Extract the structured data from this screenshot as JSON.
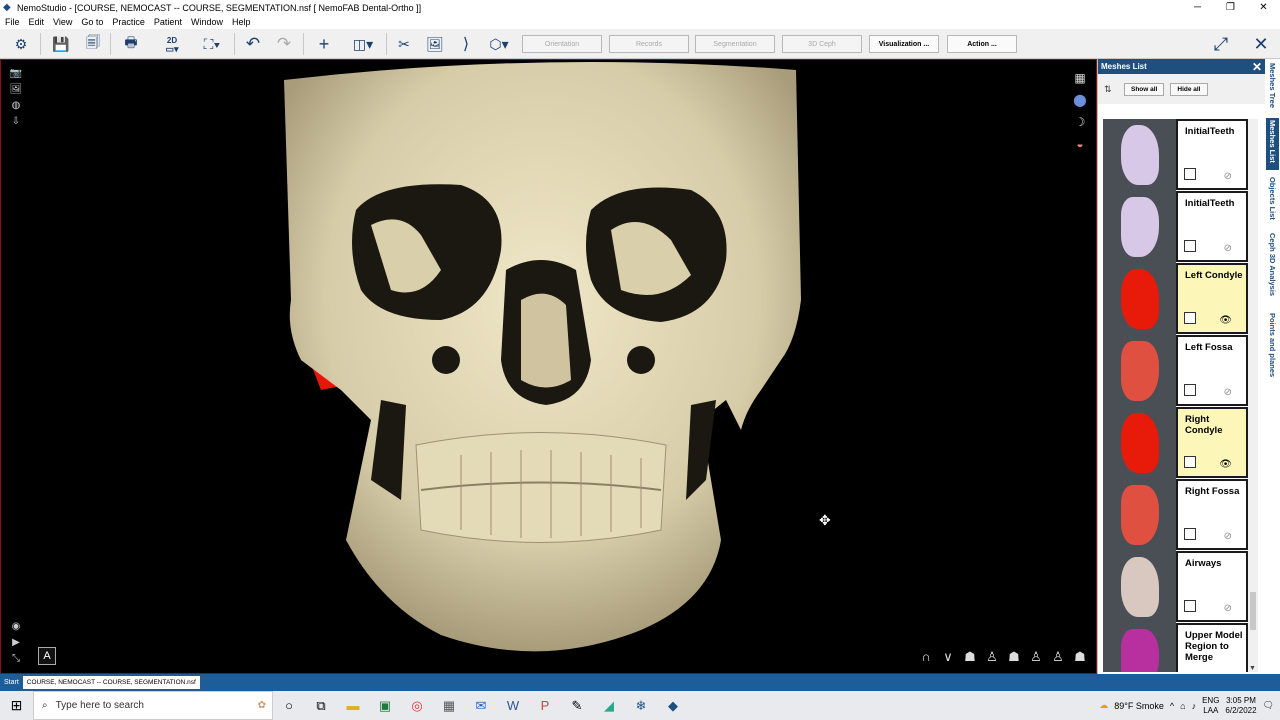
{
  "window": {
    "title": "NemoStudio - [COURSE, NEMOCAST -- COURSE, SEGMENTATION.nsf [ NemoFAB Dental-Ortho ]]",
    "minimize": "─",
    "restore": "❐",
    "close": "✕"
  },
  "menu": [
    "File",
    "Edit",
    "View",
    "Go to",
    "Practice",
    "Patient",
    "Window",
    "Help"
  ],
  "toolbar": {
    "view_2d_label": "2D",
    "steps": [
      {
        "label": "Orientation",
        "active": false
      },
      {
        "label": "Records",
        "active": false
      },
      {
        "label": "Segmentation",
        "active": false
      },
      {
        "label": "3D Ceph",
        "active": false
      },
      {
        "label": "Visualization ...",
        "active": true
      },
      {
        "label": "Action ...",
        "active": true
      }
    ]
  },
  "viewport": {
    "annotation_button": "A"
  },
  "meshes_panel": {
    "title": "Meshes List",
    "show_all": "Show all",
    "hide_all": "Hide all",
    "items": [
      {
        "name": "InitialTeeth",
        "selected": false,
        "visible": false,
        "color": "#d8c8e8"
      },
      {
        "name": "InitialTeeth",
        "selected": false,
        "visible": false,
        "color": "#d8c8e8"
      },
      {
        "name": "Left Condyle",
        "selected": true,
        "visible": true,
        "color": "#e81a0a"
      },
      {
        "name": "Left Fossa",
        "selected": false,
        "visible": false,
        "color": "#e05040"
      },
      {
        "name": "Right Condyle",
        "selected": true,
        "visible": true,
        "color": "#e81a0a"
      },
      {
        "name": "Right Fossa",
        "selected": false,
        "visible": false,
        "color": "#e05040"
      },
      {
        "name": "Airways",
        "selected": false,
        "visible": false,
        "color": "#d8c8c0"
      },
      {
        "name": "Upper Model Region to Merge",
        "selected": false,
        "visible": false,
        "color": "#b830a0"
      }
    ]
  },
  "side_tabs": [
    {
      "label": "Meshes Tree",
      "active": false
    },
    {
      "label": "Meshes List",
      "active": true
    },
    {
      "label": "Objects List",
      "active": false
    },
    {
      "label": "Ceph 3D Analysis",
      "active": false
    },
    {
      "label": "Points and planes",
      "active": false
    }
  ],
  "statusbar": {
    "start": "Start",
    "task": "COURSE, NEMOCAST -- COURSE, SEGMENTATION.nsf"
  },
  "taskbar": {
    "search_placeholder": "Type here to search",
    "weather": "89°F  Smoke",
    "lang_top": "ENG",
    "lang_bottom": "LAA",
    "time": "3:05 PM",
    "date": "6/2/2022"
  },
  "colors": {
    "accent": "#1d4f7f",
    "bone": "#ddd3b1",
    "viewport_bg": "#000000",
    "selected_row": "#fcf7b8"
  }
}
